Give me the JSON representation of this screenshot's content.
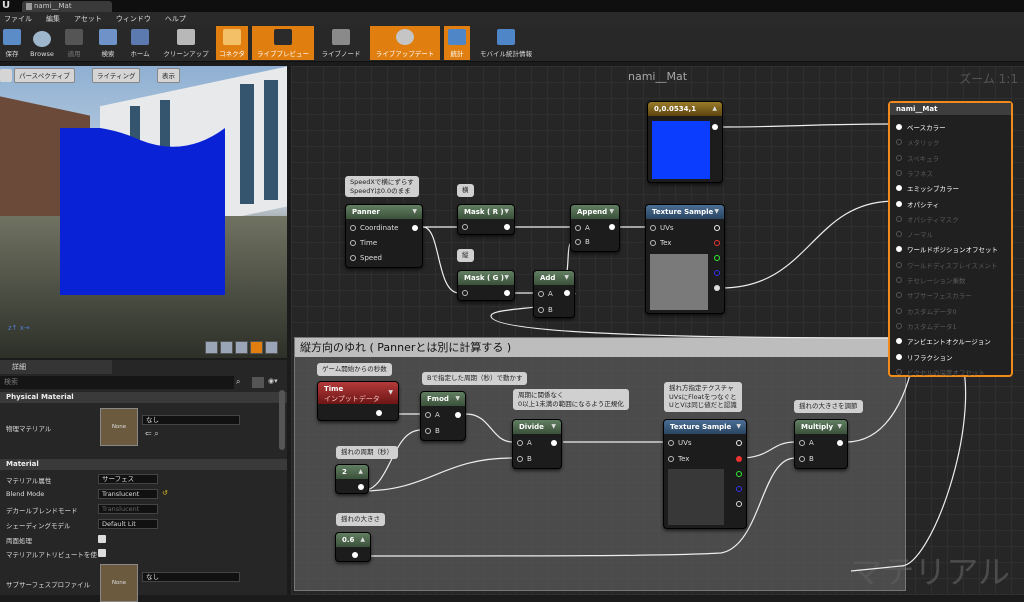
{
  "app": {
    "logo": "U",
    "tab_title": "nami__Mat"
  },
  "menu": [
    "ファイル",
    "編集",
    "アセット",
    "ウィンドウ",
    "ヘルプ"
  ],
  "toolbar": [
    {
      "label": "保存",
      "icon": "save-icon",
      "active": false
    },
    {
      "label": "Browse",
      "icon": "browse-icon",
      "active": false
    },
    {
      "label": "適用",
      "icon": "apply-icon",
      "active": false
    },
    {
      "label": "検索",
      "icon": "search-icon",
      "active": false
    },
    {
      "label": "ホーム",
      "icon": "home-icon",
      "active": false
    },
    {
      "label": "クリーンアップ",
      "icon": "cleanup-icon",
      "active": false
    },
    {
      "label": "コネクタ",
      "icon": "connector-icon",
      "active": true
    },
    {
      "label": "ライブプレビュー",
      "icon": "live-preview-icon",
      "active": true
    },
    {
      "label": "ライブノード",
      "icon": "live-node-icon",
      "active": false
    },
    {
      "label": "ライブアップデート",
      "icon": "live-update-icon",
      "active": true
    },
    {
      "label": "統計",
      "icon": "stats-icon",
      "active": true
    },
    {
      "label": "モバイル統計情報",
      "icon": "mobile-stats-icon",
      "active": false
    }
  ],
  "viewport": {
    "perspective_btn": "パースペクティブ",
    "lighting_btn": "ライティング",
    "show_btn": "表示"
  },
  "details": {
    "tab": "詳細",
    "search_placeholder": "検索",
    "physical_section": "Physical Material",
    "phys_label": "物理マテリアル",
    "phys_thumb": "None",
    "phys_value": "なし",
    "material_section": "Material",
    "rows": [
      {
        "label": "マテリアル属性",
        "value": "サーフェス",
        "type": "dropdown",
        "disabled": false
      },
      {
        "label": "Blend Mode",
        "value": "Translucent",
        "type": "dropdown",
        "disabled": false
      },
      {
        "label": "デカールブレンドモード",
        "value": "Translucent",
        "type": "dropdown",
        "disabled": true
      },
      {
        "label": "シェーディングモデル",
        "value": "Default Lit",
        "type": "dropdown",
        "disabled": false
      },
      {
        "label": "両面処理",
        "value": "",
        "type": "checkbox",
        "disabled": false
      },
      {
        "label": "マテリアルアトリビュートを使",
        "value": "",
        "type": "checkbox",
        "disabled": false
      }
    ],
    "subsurface_label": "サブサーフェスプロファイル",
    "subsurface_thumb": "None",
    "subsurface_value": "なし"
  },
  "graph": {
    "title": "nami__Mat",
    "zoom": "ズーム 1:1",
    "watermark": "マテリアル",
    "comment_title": "縦方向のゆれ ( Pannerとは別に計算する )",
    "notes": {
      "n_speed": "SpeedXで横にずらす\nSpeedYは0.0のまま",
      "n_yoko": "横",
      "n_tate": "縦",
      "n_time": "ゲーム開始からの秒数",
      "n_fmod": "Bで指定した周期（秒）で動かす",
      "n_divide": "周期に関係なく\n0以上1未満の範囲になるよう正規化",
      "n_tex": "揺れ方指定テクスチャ\nUVsにFloatをつなぐと\nUとVは同じ値だと認識",
      "n_mult": "揺れの大きさを調節",
      "n_period": "揺れの周期（秒）",
      "n_amp": "揺れの大きさ"
    },
    "nodes": {
      "color_const": {
        "title": "0,0.0534,1"
      },
      "panner": {
        "title": "Panner",
        "pins": [
          "Coordinate",
          "Time",
          "Speed"
        ]
      },
      "mask_r": {
        "title": "Mask ( R )"
      },
      "mask_g": {
        "title": "Mask ( G )"
      },
      "append": {
        "title": "Append",
        "pins": [
          "A",
          "B"
        ]
      },
      "add": {
        "title": "Add",
        "pins": [
          "A",
          "B"
        ]
      },
      "tex1": {
        "title": "Texture Sample",
        "pins": [
          "UVs",
          "Tex"
        ]
      },
      "time": {
        "title": "Time",
        "subtitle": "インプットデータ"
      },
      "fmod": {
        "title": "Fmod",
        "pins": [
          "A",
          "B"
        ]
      },
      "divide": {
        "title": "Divide",
        "pins": [
          "A",
          "B"
        ]
      },
      "tex2": {
        "title": "Texture Sample",
        "pins": [
          "UVs",
          "Tex"
        ]
      },
      "multiply": {
        "title": "Multiply",
        "pins": [
          "A",
          "B"
        ]
      },
      "const_period": {
        "value": "2"
      },
      "const_amp": {
        "value": "0.6"
      }
    },
    "result": {
      "title": "nami__Mat",
      "pins": [
        {
          "label": "ベースカラー",
          "active": true
        },
        {
          "label": "メタリック",
          "active": false
        },
        {
          "label": "スペキュラ",
          "active": false
        },
        {
          "label": "ラフネス",
          "active": false
        },
        {
          "label": "エミッシブカラー",
          "active": true
        },
        {
          "label": "オパシティ",
          "active": true
        },
        {
          "label": "オパシティマスク",
          "active": false
        },
        {
          "label": "ノーマル",
          "active": false
        },
        {
          "label": "ワールドポジションオフセット",
          "active": true
        },
        {
          "label": "ワールドディスプレイスメント",
          "active": false
        },
        {
          "label": "テセレーション乗数",
          "active": false
        },
        {
          "label": "サブサーフェスカラー",
          "active": false
        },
        {
          "label": "カスタムデータ0",
          "active": false
        },
        {
          "label": "カスタムデータ1",
          "active": false
        },
        {
          "label": "アンビエントオクルージョン",
          "active": true
        },
        {
          "label": "リフラクション",
          "active": true
        },
        {
          "label": "ピクセルの深度オフセット",
          "active": false
        }
      ]
    }
  },
  "colors": {
    "accent": "#e07f10",
    "mesh_blue": "#0a22d6",
    "const_color": "#0a3dff"
  }
}
